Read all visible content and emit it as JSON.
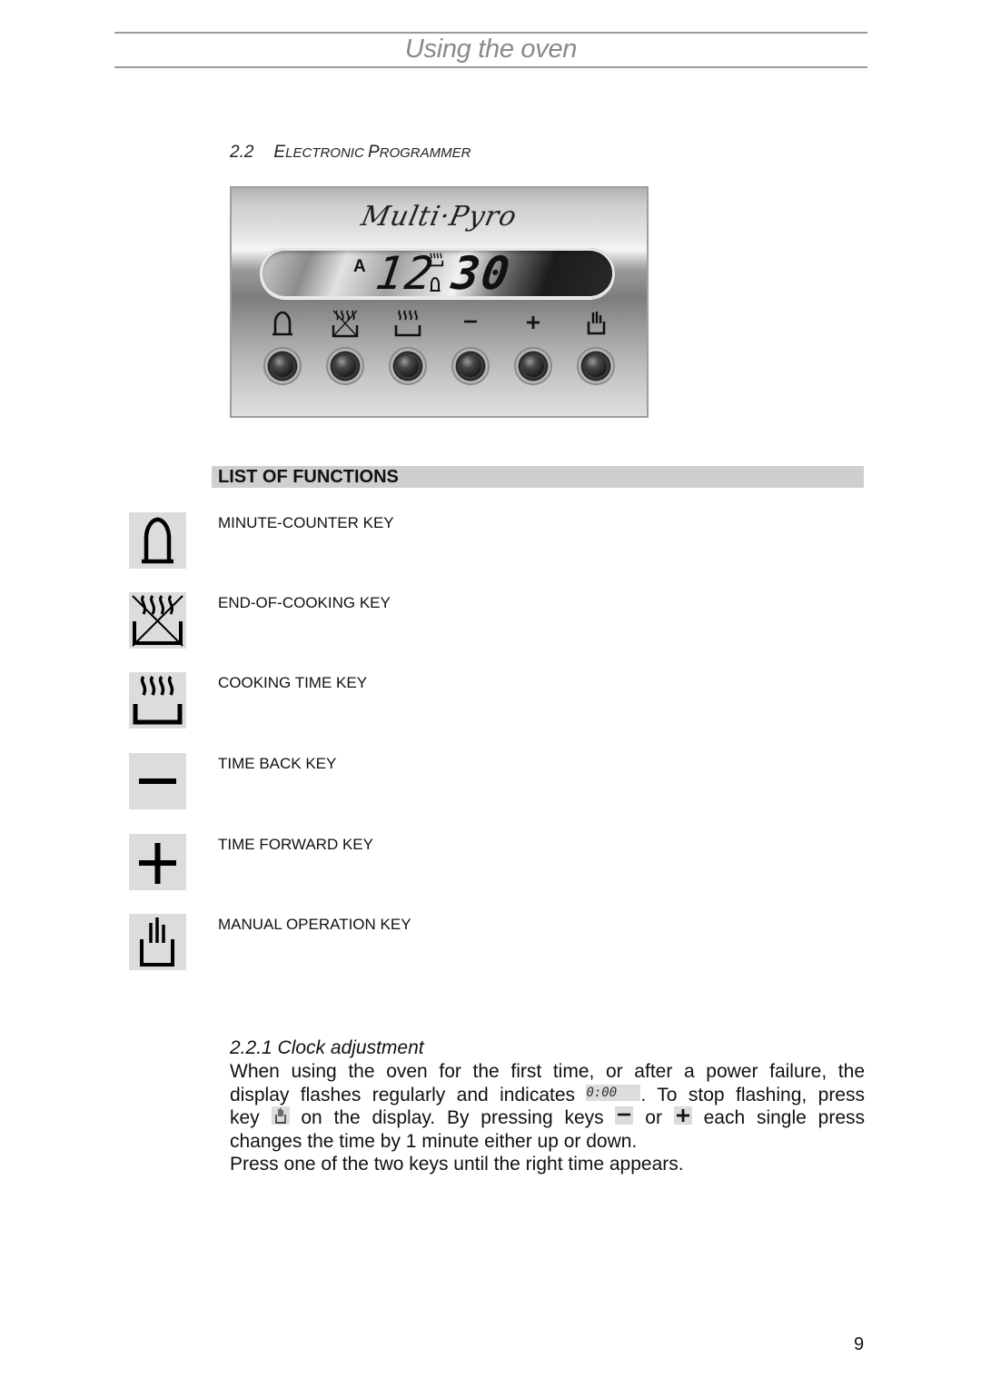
{
  "header": {
    "title": "Using the oven"
  },
  "section": {
    "number": "2.2",
    "title_first_letter": "E",
    "title_rest_1": "LECTRONIC ",
    "title_word2_first": "P",
    "title_rest_2": "ROGRAMMER"
  },
  "programmer": {
    "brand": "Multi·Pyro",
    "display": {
      "mode_indicator": "A",
      "hours": "12",
      "minutes": "30",
      "indicator_icons": [
        "cooking-time-icon",
        "bell-icon"
      ]
    },
    "keys": [
      {
        "icon": "bell-icon",
        "name": "minute-counter"
      },
      {
        "icon": "end-of-cooking-icon",
        "name": "end-of-cooking"
      },
      {
        "icon": "cooking-time-icon",
        "name": "cooking-time"
      },
      {
        "icon": "minus-icon",
        "name": "time-back"
      },
      {
        "icon": "plus-icon",
        "name": "time-forward"
      },
      {
        "icon": "hand-icon",
        "name": "manual-operation"
      }
    ]
  },
  "functions": {
    "title": "LIST OF FUNCTIONS",
    "items": [
      {
        "icon": "bell-icon",
        "label": "MINUTE-COUNTER KEY"
      },
      {
        "icon": "end-of-cooking-icon",
        "label": "END-OF-COOKING KEY"
      },
      {
        "icon": "cooking-time-icon",
        "label": "COOKING TIME KEY"
      },
      {
        "icon": "minus-icon",
        "label": "TIME BACK KEY"
      },
      {
        "icon": "plus-icon",
        "label": "TIME FORWARD KEY"
      },
      {
        "icon": "hand-icon",
        "label": "MANUAL OPERATION KEY"
      }
    ]
  },
  "clock_adjustment": {
    "title": "2.2.1 Clock adjustment",
    "line1": "When using the oven for the first time, or after a power failure, the",
    "line2_a": "display flashes regularly and indicates ",
    "display_value": "0:00",
    "line2_b": ". To stop flashing, press",
    "line3_a": "key ",
    "line3_b": " on the display. By pressing keys ",
    "line3_c": " or ",
    "line3_d": " each single press",
    "line4": "changes the time by 1 minute either up or down.",
    "line5": "Press one of the two keys until the right time appears."
  },
  "page_number": "9"
}
